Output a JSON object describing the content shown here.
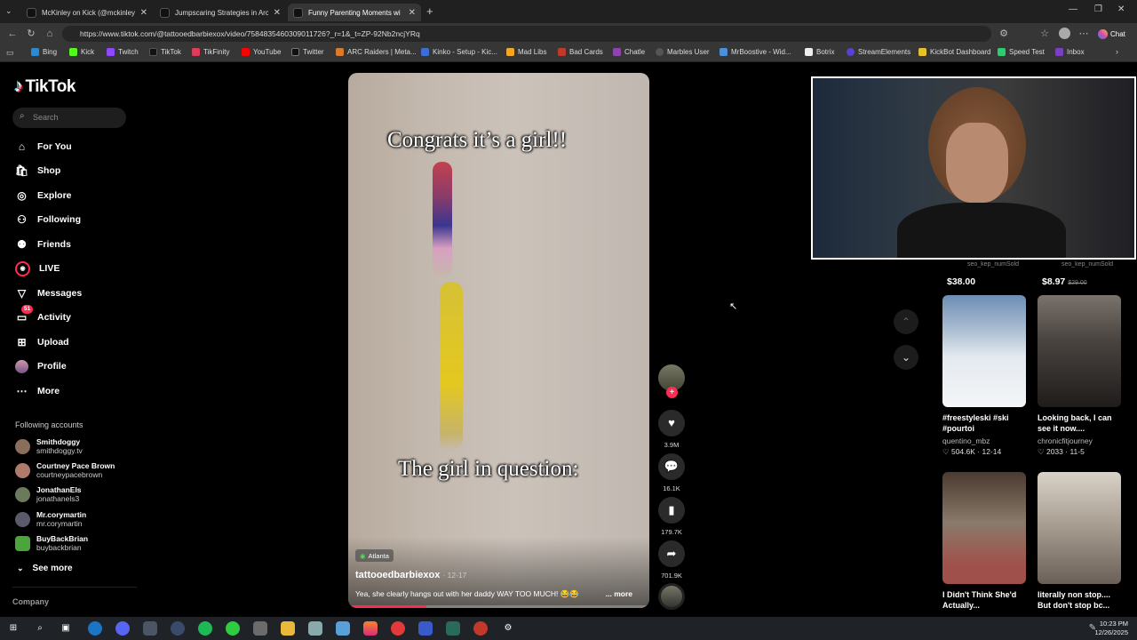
{
  "browser": {
    "tabs": [
      {
        "label": "McKinley on Kick (@mckinley.tv) | "
      },
      {
        "label": "Jumpscaring Strategies in Arc Raid"
      },
      {
        "label": "Funny Parenting Moments wi"
      }
    ],
    "url": "https://www.tiktok.com/@tattooedbarbiexox/video/7584835460309011726?_r=1&_t=ZP-92Nb2ncjYRq",
    "chat_label": "Chat",
    "bookmarks": [
      "Bing",
      "Kick",
      "Twitch",
      "TikTok",
      "TikFinity",
      "YouTube",
      "Twitter",
      "ARC Raiders | Meta...",
      "Kinko - Setup - Kic...",
      "Mad Libs",
      "Bad Cards",
      "Chatle",
      "Marbles User",
      "MrBoostive - Wid...",
      "Botrix",
      "StreamElements",
      "KickBot Dashboard",
      "Speed Test",
      "Inbox"
    ]
  },
  "sidebar": {
    "logo": "TikTok",
    "search_placeholder": "Search",
    "nav": [
      {
        "label": "For You",
        "icon": "home-icon"
      },
      {
        "label": "Shop",
        "icon": "shop-icon"
      },
      {
        "label": "Explore",
        "icon": "compass-icon"
      },
      {
        "label": "Following",
        "icon": "following-icon"
      },
      {
        "label": "Friends",
        "icon": "friends-icon"
      },
      {
        "label": "LIVE",
        "icon": "live-icon"
      },
      {
        "label": "Messages",
        "icon": "messages-icon"
      },
      {
        "label": "Activity",
        "icon": "activity-icon",
        "badge": "51"
      },
      {
        "label": "Upload",
        "icon": "upload-icon"
      },
      {
        "label": "Profile",
        "icon": "profile-icon"
      },
      {
        "label": "More",
        "icon": "more-icon"
      }
    ],
    "following_title": "Following accounts",
    "following": [
      {
        "name": "Smithdoggy",
        "handle": "smithdoggy.tv"
      },
      {
        "name": "Courtney Pace Brown",
        "handle": "courtneypacebrown"
      },
      {
        "name": "JonathanEls",
        "handle": "jonathanels3"
      },
      {
        "name": "Mr.corymartin",
        "handle": "mr.corymartin"
      },
      {
        "name": "BuyBackBrian",
        "handle": "buybackbrian"
      }
    ],
    "see_more": "See more",
    "company": "Company"
  },
  "video": {
    "caption_top": "Congrats it’s a girl!!",
    "caption_bottom": "The girl in question:",
    "location": "Atlanta",
    "author": "tattooedbarbiexox",
    "date": "· 12-17",
    "description": "Yea, she clearly hangs out with her daddy WAY TOO MUCH! 😂😂",
    "more": "... more",
    "progress": 0.26
  },
  "actions": {
    "likes": "3.9M",
    "comments": "16.1K",
    "saves": "179.7K",
    "shares": "701.9K"
  },
  "shop": {
    "items": [
      {
        "label": "seo_kep_numSold",
        "price": "$38.00"
      },
      {
        "label": "seo_kep_numSold",
        "price": "$8.97",
        "old_price": "$29.00"
      }
    ]
  },
  "recommended": [
    {
      "title": "#freestyleski #ski #pourtoi",
      "user": "quentino_mbz",
      "meta": "♡ 504.6K · 12-14"
    },
    {
      "title": "Looking back, I can see it now....",
      "user": "chronicfitjourney",
      "meta": "♡ 2033 · 11-5"
    },
    {
      "title": "I Didn't Think She'd Actually...",
      "user": "",
      "meta": ""
    },
    {
      "title": "literally non stop.... But don't stop bc...",
      "user": "",
      "meta": ""
    }
  ],
  "taskbar": {
    "time": "10:23 PM",
    "date": "12/26/2025"
  },
  "colors": {
    "accent": "#fe2c55",
    "background": "#000000"
  }
}
